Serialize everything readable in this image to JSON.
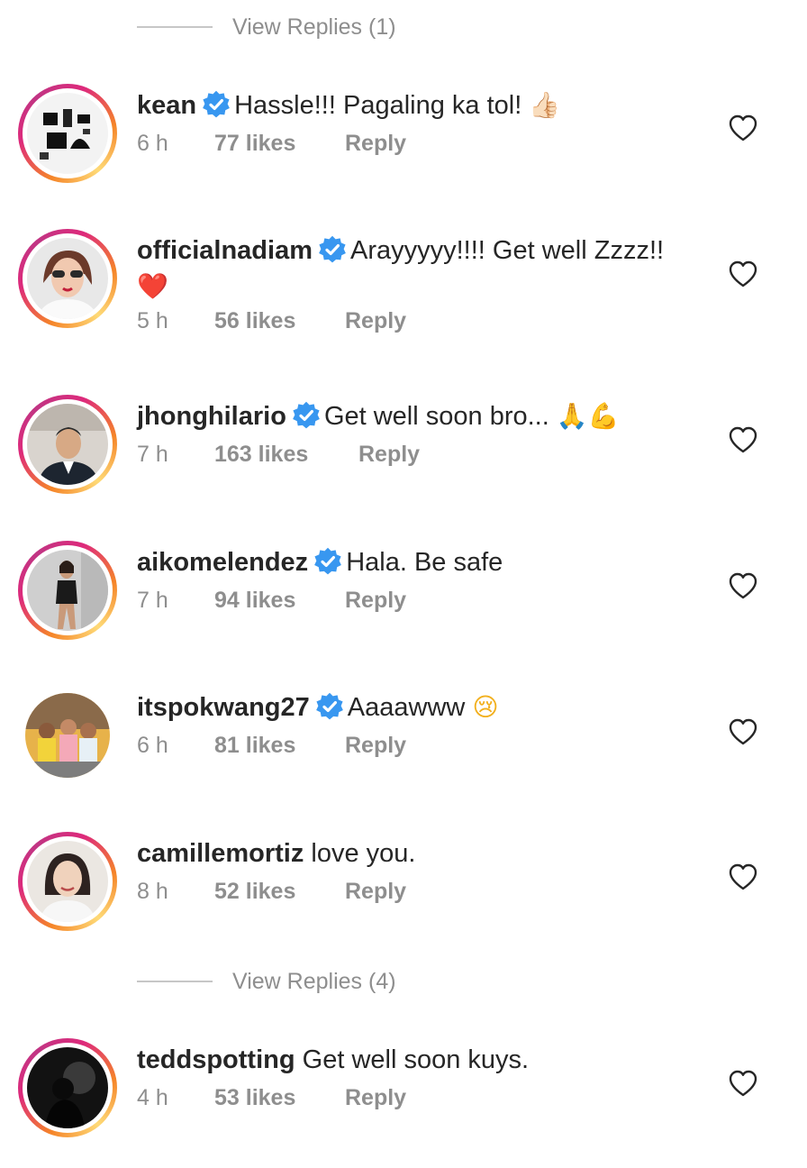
{
  "view_replies": [
    {
      "label": "View Replies (1)"
    },
    {
      "label": "View Replies (4)"
    }
  ],
  "comments": [
    {
      "username": "kean",
      "verified": true,
      "text": "Hassle!!! Pagaling ka tol!",
      "emoji": "👍🏻",
      "time": "6 h",
      "likes": "77 likes",
      "reply": "Reply"
    },
    {
      "username": "officialnadiam",
      "verified": true,
      "text": "Arayyyyy!!!! Get well Zzzz!!",
      "emoji": "❤️",
      "time": "5 h",
      "likes": "56 likes",
      "reply": "Reply"
    },
    {
      "username": "jhonghilario",
      "verified": true,
      "text": "Get well soon bro...",
      "emoji": "🙏💪",
      "time": "7 h",
      "likes": "163 likes",
      "reply": "Reply"
    },
    {
      "username": "aikomelendez",
      "verified": true,
      "text": "Hala. Be safe",
      "emoji": "",
      "time": "7 h",
      "likes": "94 likes",
      "reply": "Reply"
    },
    {
      "username": "itspokwang27",
      "verified": true,
      "text": "Aaaawww",
      "emoji": "😢",
      "time": "6 h",
      "likes": "81 likes",
      "reply": "Reply"
    },
    {
      "username": "camillemortiz",
      "verified": false,
      "text": "love you.",
      "emoji": "",
      "time": "8 h",
      "likes": "52 likes",
      "reply": "Reply"
    },
    {
      "username": "teddspotting",
      "verified": false,
      "text": "Get well soon kuys.",
      "emoji": "",
      "time": "4 h",
      "likes": "53 likes",
      "reply": "Reply"
    }
  ],
  "icons": {
    "verified_badge": "verified-badge-icon",
    "like": "heart-outline-icon"
  },
  "colors": {
    "verified": "#3897f0",
    "muted_text": "#8e8e8e",
    "story_ring_start": "#f58529",
    "story_ring_end": "#dd2a7b"
  }
}
